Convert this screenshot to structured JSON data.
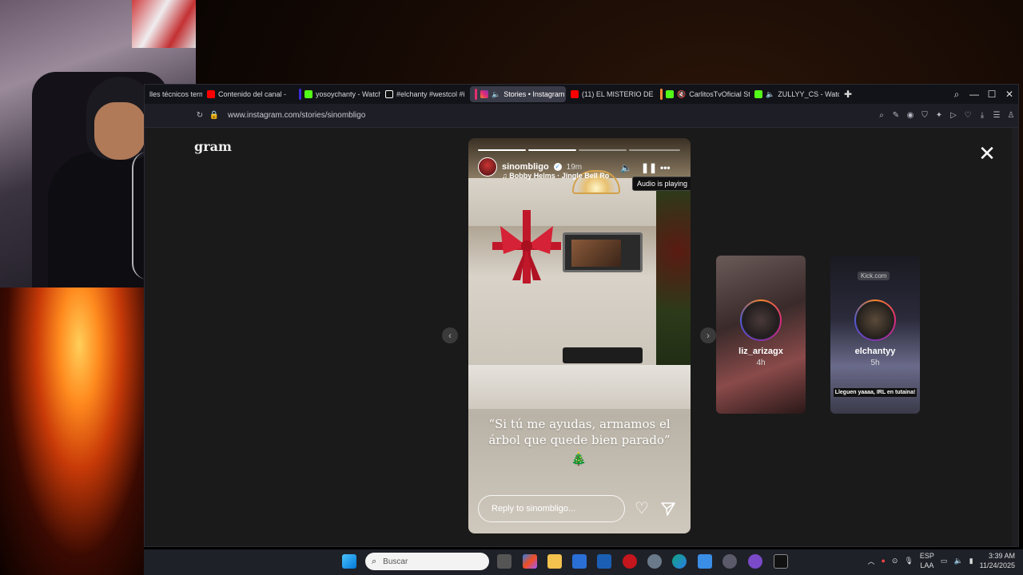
{
  "browser": {
    "tabs": [
      {
        "label": "lles técnicos term",
        "favicon_color": "#ffffff",
        "accent": ""
      },
      {
        "label": "Contenido del canal -",
        "favicon_color": "#ff0000",
        "accent": ""
      },
      {
        "label": "yosoychanty - Watch t",
        "favicon_color": "#53fc18",
        "accent": "#3b2bd6"
      },
      {
        "label": "#elchanty #westcol #i",
        "favicon_color": "#ffffff",
        "accent": ""
      },
      {
        "label": "Stories • Instagram",
        "favicon_color": "#e1306c",
        "accent": "#e1306c"
      },
      {
        "label": "(11) EL MISTERIO DE P",
        "favicon_color": "#ff0000",
        "accent": ""
      },
      {
        "label": "CarlitosTvOficial St",
        "favicon_color": "#53fc18",
        "accent": "#ff8a3a"
      },
      {
        "label": "ZULLYY_CS - Watc",
        "favicon_color": "#53fc18",
        "accent": ""
      }
    ],
    "url": "www.instagram.com/stories/sinombligo"
  },
  "instagram": {
    "logo_text": "gram",
    "close_label": "✕"
  },
  "story": {
    "username": "sinombligo",
    "time": "19m",
    "song": "Bobby Helms · Jingle Bell Ro",
    "tooltip": "Audio is playing",
    "caption": "“Si tú me ayudas, armamos el árbol que quede bien parado”",
    "emoji": "🎄",
    "reply_placeholder": "Reply to sinombligo...",
    "progress_segments": 4,
    "progress_done": 2
  },
  "previews": [
    {
      "name": "liz_arizagx",
      "time": "4h"
    },
    {
      "name": "elchantyy",
      "time": "5h",
      "overlay_text": "Lleguen yaaaa, IRL en tutaina!",
      "badge": "Kick.com"
    }
  ],
  "taskbar": {
    "search_placeholder": "Buscar",
    "lang": "ESP",
    "lang2": "LAA",
    "time": "3:39 AM",
    "date": "11/24/2025"
  }
}
